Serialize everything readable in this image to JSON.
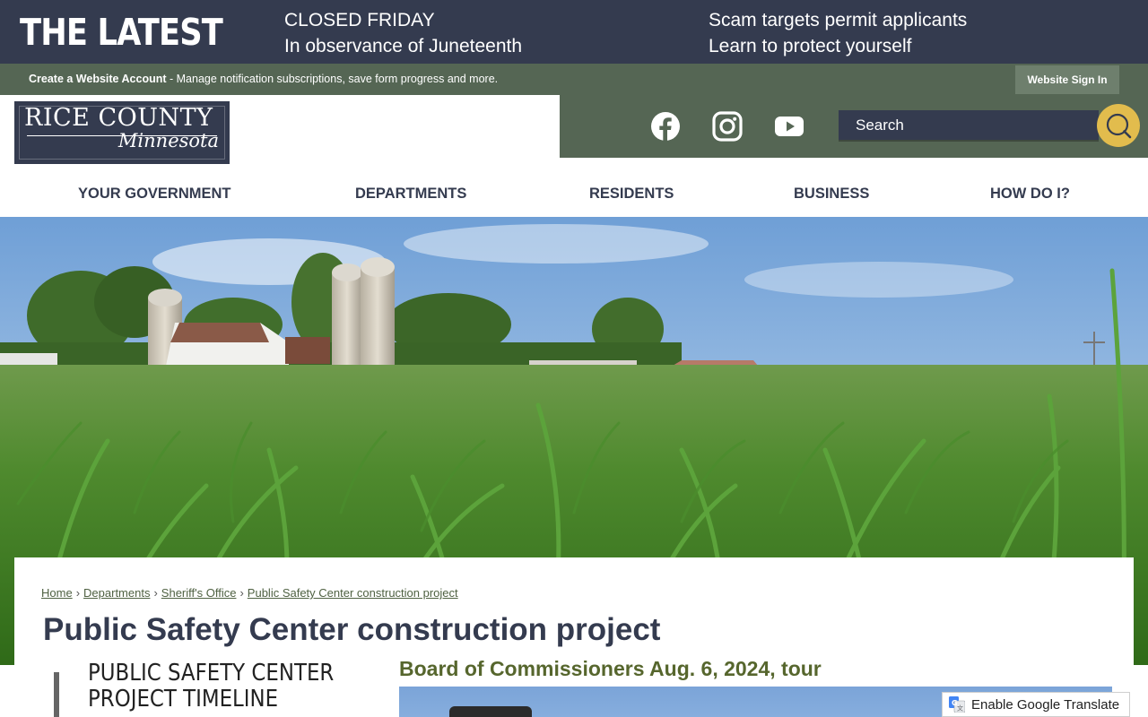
{
  "alert": {
    "heading": "THE LATEST",
    "items": [
      {
        "line1": "CLOSED FRIDAY",
        "line2": "In observance of Juneteenth"
      },
      {
        "line1": "Scam targets permit applicants",
        "line2": "Learn to protect yourself"
      }
    ]
  },
  "account_bar": {
    "create_link": "Create a Website Account",
    "description": " - Manage notification subscriptions, save form progress and more.",
    "sign_in": "Website Sign In"
  },
  "logo": {
    "main": "RICE COUNTY",
    "sub": "Minnesota"
  },
  "social": [
    "facebook-icon",
    "instagram-icon",
    "youtube-icon"
  ],
  "search": {
    "placeholder": "Search"
  },
  "nav": {
    "items": [
      "YOUR GOVERNMENT",
      "DEPARTMENTS",
      "RESIDENTS",
      "BUSINESS",
      "HOW DO I?"
    ]
  },
  "breadcrumb": {
    "items": [
      "Home",
      "Departments",
      "Sheriff's Office",
      "Public Safety Center construction project"
    ],
    "separator": "›"
  },
  "page": {
    "title": "Public Safety Center construction project",
    "timeline_line1": "PUBLIC SAFETY CENTER",
    "timeline_line2": "PROJECT TIMELINE",
    "section_heading": "Board of Commissioners Aug. 6, 2024, tour"
  },
  "translate": {
    "label": "Enable Google Translate"
  },
  "colors": {
    "navy": "#343b4f",
    "sage": "#556654",
    "gold": "#e2bc4d",
    "olive_heading": "#56662d"
  }
}
